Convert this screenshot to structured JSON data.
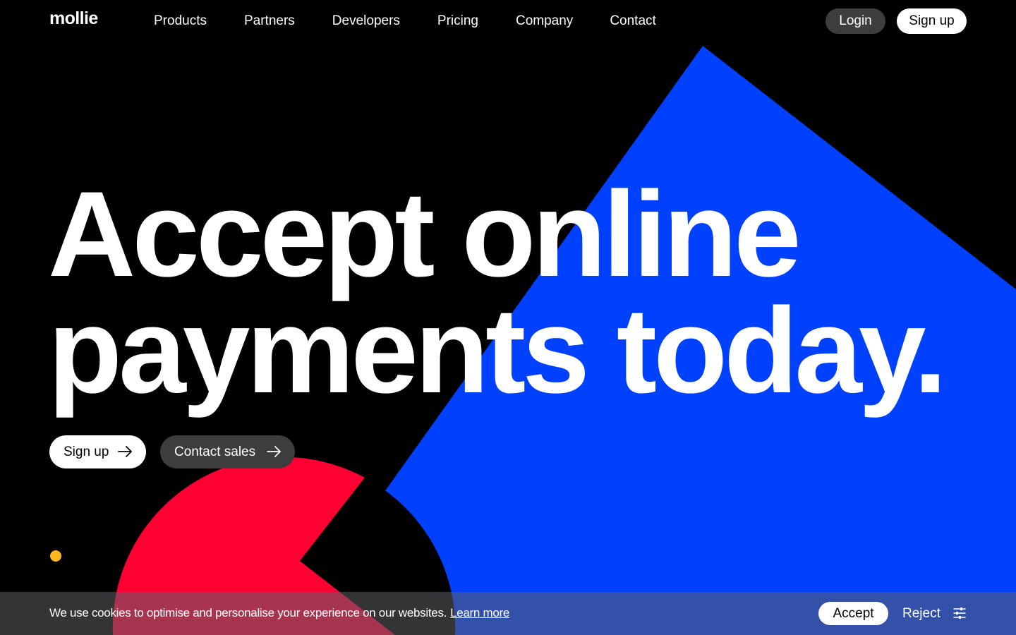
{
  "brand": {
    "logo_text": "mollie"
  },
  "nav": {
    "items": [
      "Products",
      "Partners",
      "Developers",
      "Pricing",
      "Company",
      "Contact"
    ]
  },
  "header_actions": {
    "login_label": "Login",
    "signup_label": "Sign up"
  },
  "hero": {
    "title_line1": "Accept online",
    "title_line2": "payments today.",
    "cta_signup_label": "Sign up",
    "cta_contact_label": "Contact sales"
  },
  "cookie_bar": {
    "message": "We use cookies to optimise and personalise your experience on our websites.",
    "learn_more_label": "Learn more",
    "accept_label": "Accept",
    "reject_label": "Reject"
  },
  "colors": {
    "background": "#000000",
    "blue_shape": "#0040ff",
    "red_shape": "#ff0033",
    "dot_accent": "#ffb81c",
    "button_dark": "#3d3d3d",
    "button_light": "#ffffff"
  },
  "icons": {
    "arrow": "arrow-right-icon",
    "settings": "sliders-icon"
  }
}
